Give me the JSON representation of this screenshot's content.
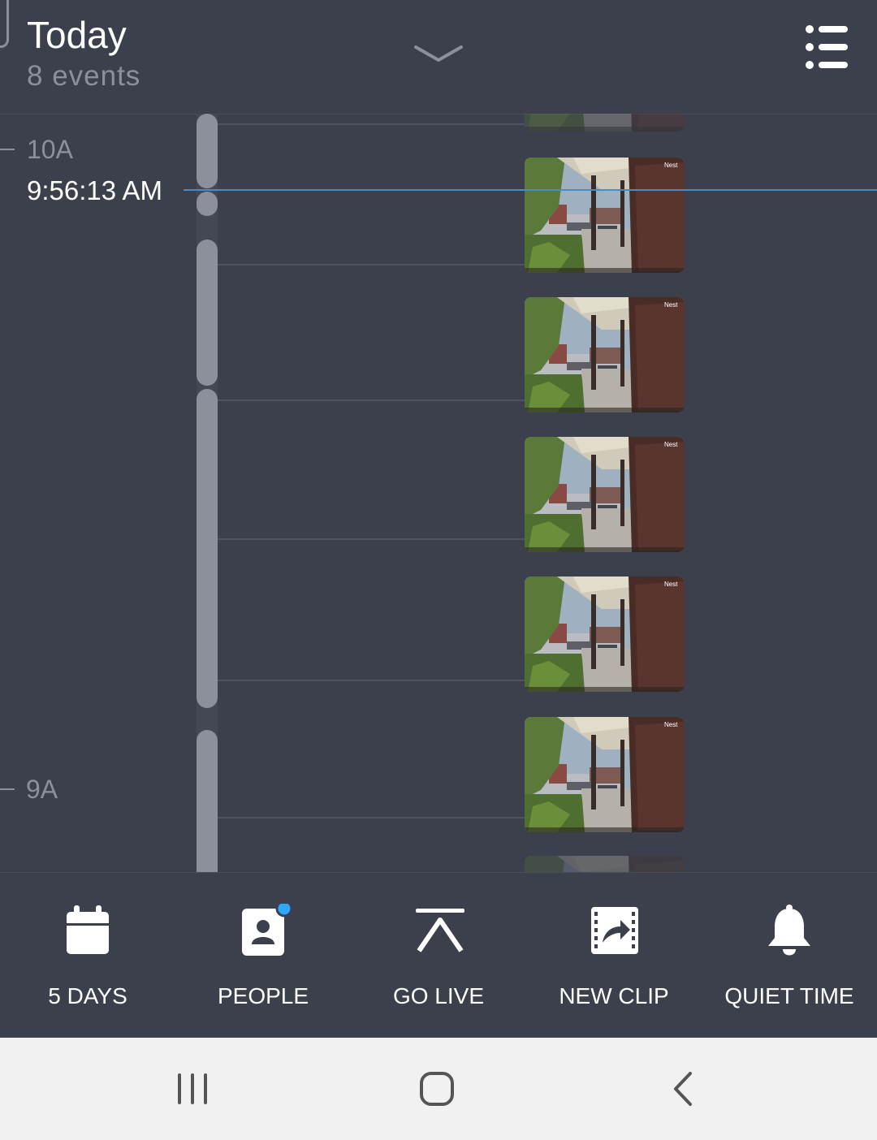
{
  "header": {
    "title": "Today",
    "subtitle": "8 events"
  },
  "timeline": {
    "hour_labels": [
      "10A",
      "9A"
    ],
    "current_time": "9:56:13 AM",
    "thumbnail_watermark": "Nest"
  },
  "bottom_nav": {
    "items": [
      {
        "label": "5 DAYS",
        "icon": "calendar-icon"
      },
      {
        "label": "PEOPLE",
        "icon": "people-icon",
        "badge": true
      },
      {
        "label": "GO LIVE",
        "icon": "go-live-icon"
      },
      {
        "label": "NEW CLIP",
        "icon": "new-clip-icon"
      },
      {
        "label": "QUIET TIME",
        "icon": "bell-icon"
      }
    ]
  },
  "system_nav": {
    "icons": [
      "recents-icon",
      "home-icon",
      "back-icon"
    ]
  },
  "colors": {
    "background": "#3c404c",
    "accent_line": "#3f8fd0",
    "badge": "#2ea7ff",
    "muted_text": "#8d909a",
    "system_bar": "#f1f1f1"
  }
}
